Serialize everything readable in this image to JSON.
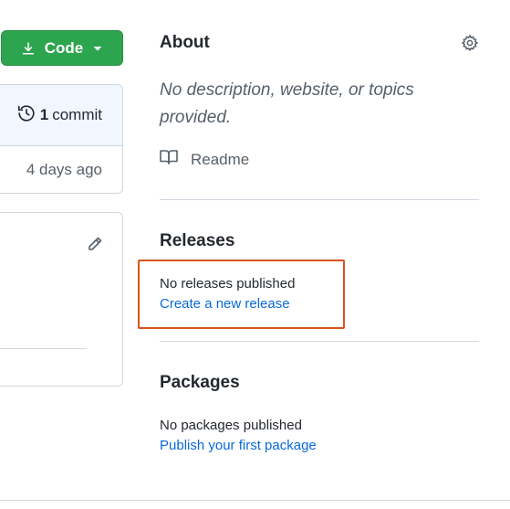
{
  "code_button": {
    "label": "Code"
  },
  "commit_box": {
    "count": "1",
    "commit_word": "commit",
    "time_ago": "4 days ago"
  },
  "about": {
    "heading": "About",
    "description": "No description, website, or topics provided.",
    "readme_label": "Readme"
  },
  "releases": {
    "heading": "Releases",
    "empty_text": "No releases published",
    "create_link": "Create a new release"
  },
  "packages": {
    "heading": "Packages",
    "empty_text": "No packages published",
    "publish_link": "Publish your first package"
  },
  "colors": {
    "primary_button": "#2da44e",
    "link": "#0969da",
    "highlight_border": "#d9531e"
  },
  "icons": [
    "download-icon",
    "caret-down-icon",
    "history-icon",
    "pencil-icon",
    "gear-icon",
    "book-icon"
  ]
}
